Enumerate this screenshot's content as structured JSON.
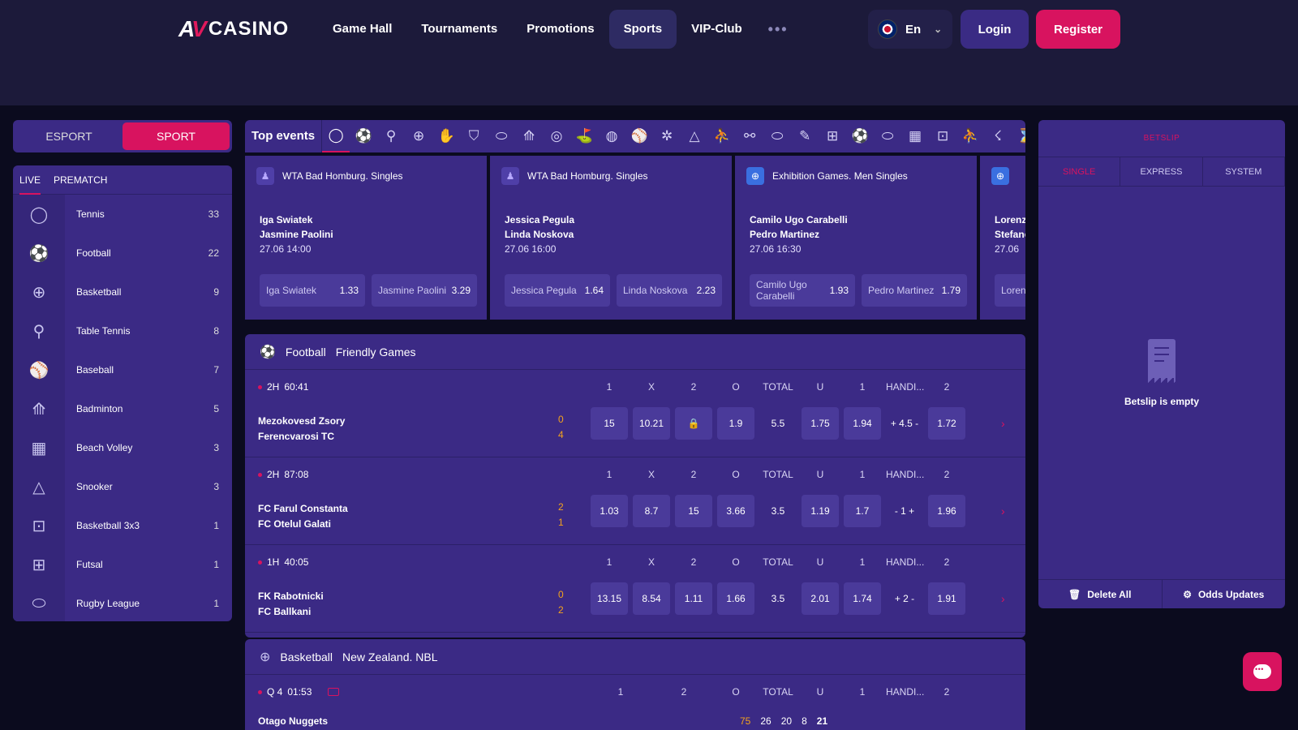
{
  "header": {
    "logo_mark_a": "A",
    "logo_mark_v": "V",
    "logo_text": "CASINO",
    "nav": [
      "Game Hall",
      "Tournaments",
      "Promotions",
      "Sports",
      "VIP-Club"
    ],
    "nav_more": "•••",
    "language": "En",
    "login": "Login",
    "register": "Register"
  },
  "mode": {
    "esport": "ESPORT",
    "sport": "SPORT"
  },
  "sidebar": {
    "tabs": [
      "LIVE",
      "PREMATCH"
    ],
    "items": [
      {
        "label": "Tennis",
        "count": "33",
        "icon": "tennis-icon",
        "glyph": "◯"
      },
      {
        "label": "Football",
        "count": "22",
        "icon": "football-icon",
        "glyph": "⚽"
      },
      {
        "label": "Basketball",
        "count": "9",
        "icon": "basketball-icon",
        "glyph": "⊕"
      },
      {
        "label": "Table Tennis",
        "count": "8",
        "icon": "table-tennis-icon",
        "glyph": "⚲"
      },
      {
        "label": "Baseball",
        "count": "7",
        "icon": "baseball-icon",
        "glyph": "⚾"
      },
      {
        "label": "Badminton",
        "count": "5",
        "icon": "badminton-icon",
        "glyph": "⟰"
      },
      {
        "label": "Beach Volley",
        "count": "3",
        "icon": "beach-volley-icon",
        "glyph": "▦"
      },
      {
        "label": "Snooker",
        "count": "3",
        "icon": "snooker-icon",
        "glyph": "△"
      },
      {
        "label": "Basketball 3x3",
        "count": "1",
        "icon": "basketball-3x3-icon",
        "glyph": "⊡"
      },
      {
        "label": "Futsal",
        "count": "1",
        "icon": "futsal-icon",
        "glyph": "⊞"
      },
      {
        "label": "Rugby League",
        "count": "1",
        "icon": "rugby-icon",
        "glyph": "⬭"
      }
    ]
  },
  "top_events": {
    "label": "Top events",
    "icons": [
      "◯",
      "⚽",
      "⚲",
      "⊕",
      "✋",
      "⛉",
      "⬭",
      "⟰",
      "◎",
      "⛳",
      "◍",
      "⚾",
      "✲",
      "△",
      "⛹",
      "⚯",
      "⬭",
      "✎",
      "⊞",
      "⚽",
      "⬭",
      "▦",
      "⊡",
      "⛹",
      "☇",
      "⌛"
    ],
    "cards": [
      {
        "league": "WTA Bad Homburg. Singles",
        "team1": "Iga Swiatek",
        "team2": "Jasmine Paolini",
        "date": "27.06",
        "time": "14:00",
        "odd1_name": "Iga Swiatek",
        "odd1": "1.33",
        "odd2_name": "Jasmine Paolini",
        "odd2": "3.29"
      },
      {
        "league": "WTA Bad Homburg. Singles",
        "team1": "Jessica Pegula",
        "team2": "Linda Noskova",
        "date": "27.06",
        "time": "16:00",
        "odd1_name": "Jessica Pegula",
        "odd1": "1.64",
        "odd2_name": "Linda Noskova",
        "odd2": "2.23"
      },
      {
        "league": "Exhibition Games. Men Singles",
        "team1": "Camilo Ugo Carabelli",
        "team2": "Pedro Martinez",
        "date": "27.06",
        "time": "16:30",
        "odd1_name": "Camilo Ugo Carabelli",
        "odd1": "1.93",
        "odd2_name": "Pedro Martinez",
        "odd2": "1.79"
      },
      {
        "league": "",
        "team1": "Lorenzo",
        "team2": "Stefano",
        "date": "27.06",
        "time": "",
        "odd1_name": "Loren",
        "odd1": "",
        "odd2_name": "",
        "odd2": ""
      }
    ]
  },
  "football": {
    "sport": "Football",
    "league": "Friendly Games",
    "columns": [
      "1",
      "X",
      "2",
      "O",
      "TOTAL",
      "U",
      "1",
      "HANDI...",
      "2"
    ],
    "matches": [
      {
        "period": "2H",
        "clock": "60:41",
        "team1": "Mezokovesd Zsory",
        "team2": "Ferencvarosi TC",
        "score1": "0",
        "score2": "4",
        "odds": [
          "15",
          "10.21",
          "",
          "1.9",
          "5.5",
          "1.75",
          "1.94",
          "+ 4.5 -",
          "1.72"
        ]
      },
      {
        "period": "2H",
        "clock": "87:08",
        "team1": "FC Farul Constanta",
        "team2": "FC Otelul Galati",
        "score1": "2",
        "score2": "1",
        "odds": [
          "1.03",
          "8.7",
          "15",
          "3.66",
          "3.5",
          "1.19",
          "1.7",
          "- 1 +",
          "1.96"
        ]
      },
      {
        "period": "1H",
        "clock": "40:05",
        "team1": "FK Rabotnicki",
        "team2": "FC Ballkani",
        "score1": "0",
        "score2": "2",
        "odds": [
          "13.15",
          "8.54",
          "1.11",
          "1.66",
          "3.5",
          "2.01",
          "1.74",
          "+ 2 -",
          "1.91"
        ]
      }
    ]
  },
  "basketball": {
    "sport": "Basketball",
    "league": "New Zealand. NBL",
    "columns": [
      "1",
      "2",
      "O",
      "TOTAL",
      "U",
      "1",
      "HANDI...",
      "2"
    ],
    "match": {
      "period": "Q 4",
      "clock": "01:53",
      "team1": "Otago Nuggets",
      "score": "75",
      "q1": "26",
      "q2": "20",
      "q3": "8",
      "q4": "21"
    }
  },
  "betslip": {
    "title": "BETSLIP",
    "tabs": [
      "SINGLE",
      "EXPRESS",
      "SYSTEM"
    ],
    "empty": "Betslip is empty",
    "delete_all": "Delete All",
    "odds_updates": "Odds Updates"
  },
  "colors": {
    "accent": "#d8135f",
    "panel": "#3b2a85",
    "header": "#1c1a3a",
    "score": "#f3a21d"
  }
}
